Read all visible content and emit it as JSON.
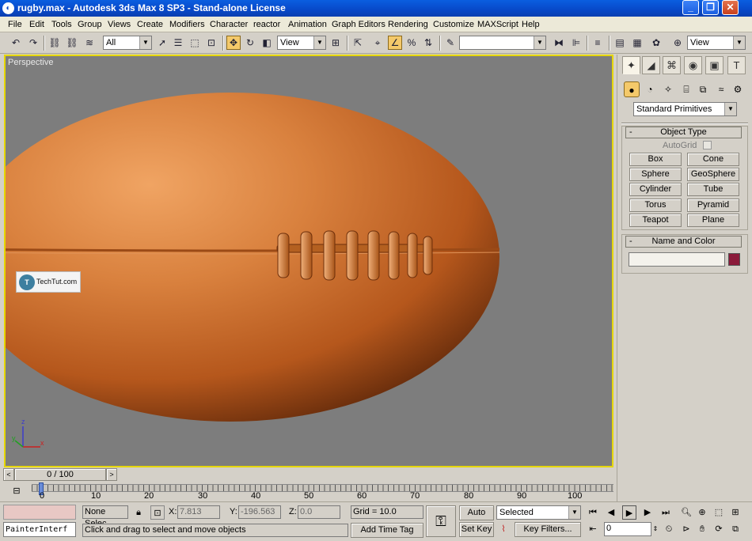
{
  "window": {
    "title": "rugby.max - Autodesk 3ds Max 8 SP3 - Stand-alone License"
  },
  "menu": [
    "File",
    "Edit",
    "Tools",
    "Group",
    "Views",
    "Create",
    "Modifiers",
    "Character",
    "reactor",
    "Animation",
    "Graph Editors",
    "Rendering",
    "Customize",
    "MAXScript",
    "Help"
  ],
  "toolbar": {
    "selection_filter": "All",
    "ref_coord_1": "View",
    "named_selection": "",
    "ref_coord_2": "View"
  },
  "viewport": {
    "label": "Perspective",
    "watermark": "TechTut.com",
    "axis_x": "x",
    "axis_y": "y",
    "axis_z": "z"
  },
  "command_panel": {
    "category": "Standard Primitives",
    "object_type_title": "Object Type",
    "autogrid_label": "AutoGrid",
    "buttons": [
      "Box",
      "Cone",
      "Sphere",
      "GeoSphere",
      "Cylinder",
      "Tube",
      "Torus",
      "Pyramid",
      "Teapot",
      "Plane"
    ],
    "name_color_title": "Name and Color",
    "name_value": "",
    "color": "#8b1a3a"
  },
  "timeline": {
    "slider_label": "0 / 100",
    "ticks": [
      "0",
      "10",
      "20",
      "30",
      "40",
      "50",
      "60",
      "70",
      "80",
      "90",
      "100"
    ]
  },
  "status": {
    "maxscript_text": "PainterInterf",
    "selection": "None Selec",
    "x_label": "X:",
    "x_value": "7.813",
    "y_label": "Y:",
    "y_value": "-196.563",
    "z_label": "Z:",
    "z_value": "0.0",
    "grid": "Grid = 10.0",
    "prompt": "Click and drag to select and move objects",
    "add_time_tag": "Add Time Tag",
    "auto_key": "Auto Key",
    "set_key": "Set Key",
    "key_mode": "Selected",
    "key_filters": "Key Filters...",
    "frame": "0"
  },
  "colors": {
    "selection_accent": "#f4c96a",
    "viewport_border": "#e6d700",
    "ball_base": "#c8692a",
    "viewport_bg": "#7d7d7d"
  }
}
